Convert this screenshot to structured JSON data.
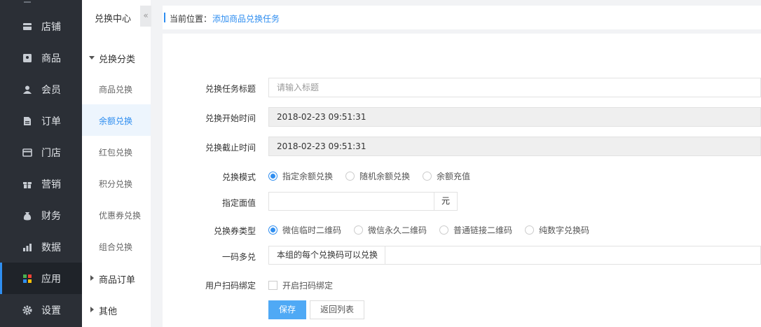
{
  "sidebar": {
    "items": [
      {
        "label": "店铺",
        "icon": "store-icon"
      },
      {
        "label": "商品",
        "icon": "goods-icon"
      },
      {
        "label": "会员",
        "icon": "member-icon"
      },
      {
        "label": "订单",
        "icon": "order-icon"
      },
      {
        "label": "门店",
        "icon": "shop-icon"
      },
      {
        "label": "营销",
        "icon": "gift-icon"
      },
      {
        "label": "财务",
        "icon": "money-bag-icon"
      },
      {
        "label": "数据",
        "icon": "bar-chart-icon"
      },
      {
        "label": "应用",
        "icon": "apps-grid-icon",
        "active": true
      },
      {
        "label": "设置",
        "icon": "gear-icon"
      }
    ]
  },
  "subnav": {
    "title": "兑换中心",
    "collapse_glyph": "«",
    "group1": "兑换分类",
    "items": [
      "商品兑换",
      "余额兑换",
      "红包兑换",
      "积分兑换",
      "优惠券兑换",
      "组合兑换"
    ],
    "group2": "商品订单",
    "group3": "其他"
  },
  "breadcrumb": {
    "prefix": "当前位置：",
    "current": "添加商品兑换任务"
  },
  "form": {
    "title_label": "兑换任务标题",
    "title_placeholder": "请输入标题",
    "start_label": "兑换开始时间",
    "start_value": "2018-02-23 09:51:31",
    "end_label": "兑换截止时间",
    "end_value": "2018-02-23 09:51:31",
    "mode_label": "兑换模式",
    "mode_options": [
      "指定余额兑换",
      "随机余额兑换",
      "余额充值"
    ],
    "amount_label": "指定面值",
    "amount_unit": "元",
    "code_type_label": "兑换券类型",
    "code_type_options": [
      "微信临时二维码",
      "微信永久二维码",
      "普通链接二维码",
      "纯数字兑换码"
    ],
    "multi_label": "一码多兑",
    "multi_value": "本组的每个兑换码可以兑换",
    "bind_label": "用户扫码绑定",
    "bind_option": "开启扫码绑定",
    "save_label": "保存",
    "back_label": "返回列表"
  },
  "colors": {
    "sidebar_bg": "#2b2f36",
    "accent": "#2f8ef0",
    "primary_button": "#4fa9f5"
  }
}
